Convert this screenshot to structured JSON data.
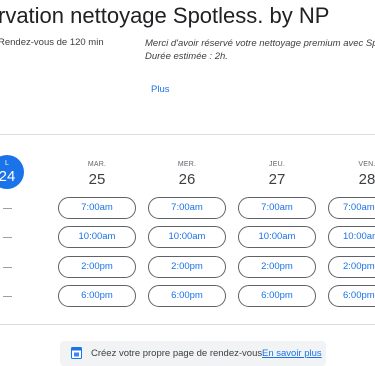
{
  "header": {
    "title": "rvation nettoyage Spotless. by NP",
    "duration": "Rendez-vous de 120 min",
    "description_line1": "Merci d'avoir réservé votre nettoyage premium avec Spotle",
    "description_line2": "Durée estimée : 2h.",
    "more_link": "Plus"
  },
  "today": {
    "dow": "L",
    "num": "24"
  },
  "days": [
    {
      "dow": "MAR.",
      "num": "25"
    },
    {
      "dow": "MER.",
      "num": "26"
    },
    {
      "dow": "JEU.",
      "num": "27"
    },
    {
      "dow": "VEN.",
      "num": "28"
    }
  ],
  "slots": [
    "7:00am",
    "10:00am",
    "2:00pm",
    "6:00pm"
  ],
  "footer": {
    "text": "Créez votre propre page de rendez-vous.",
    "link": "En savoir plus",
    "icon": "calendar-icon"
  },
  "colors": {
    "accent": "#1a73e8",
    "border": "#5f6368",
    "footer_bg": "#f1f3f4"
  }
}
